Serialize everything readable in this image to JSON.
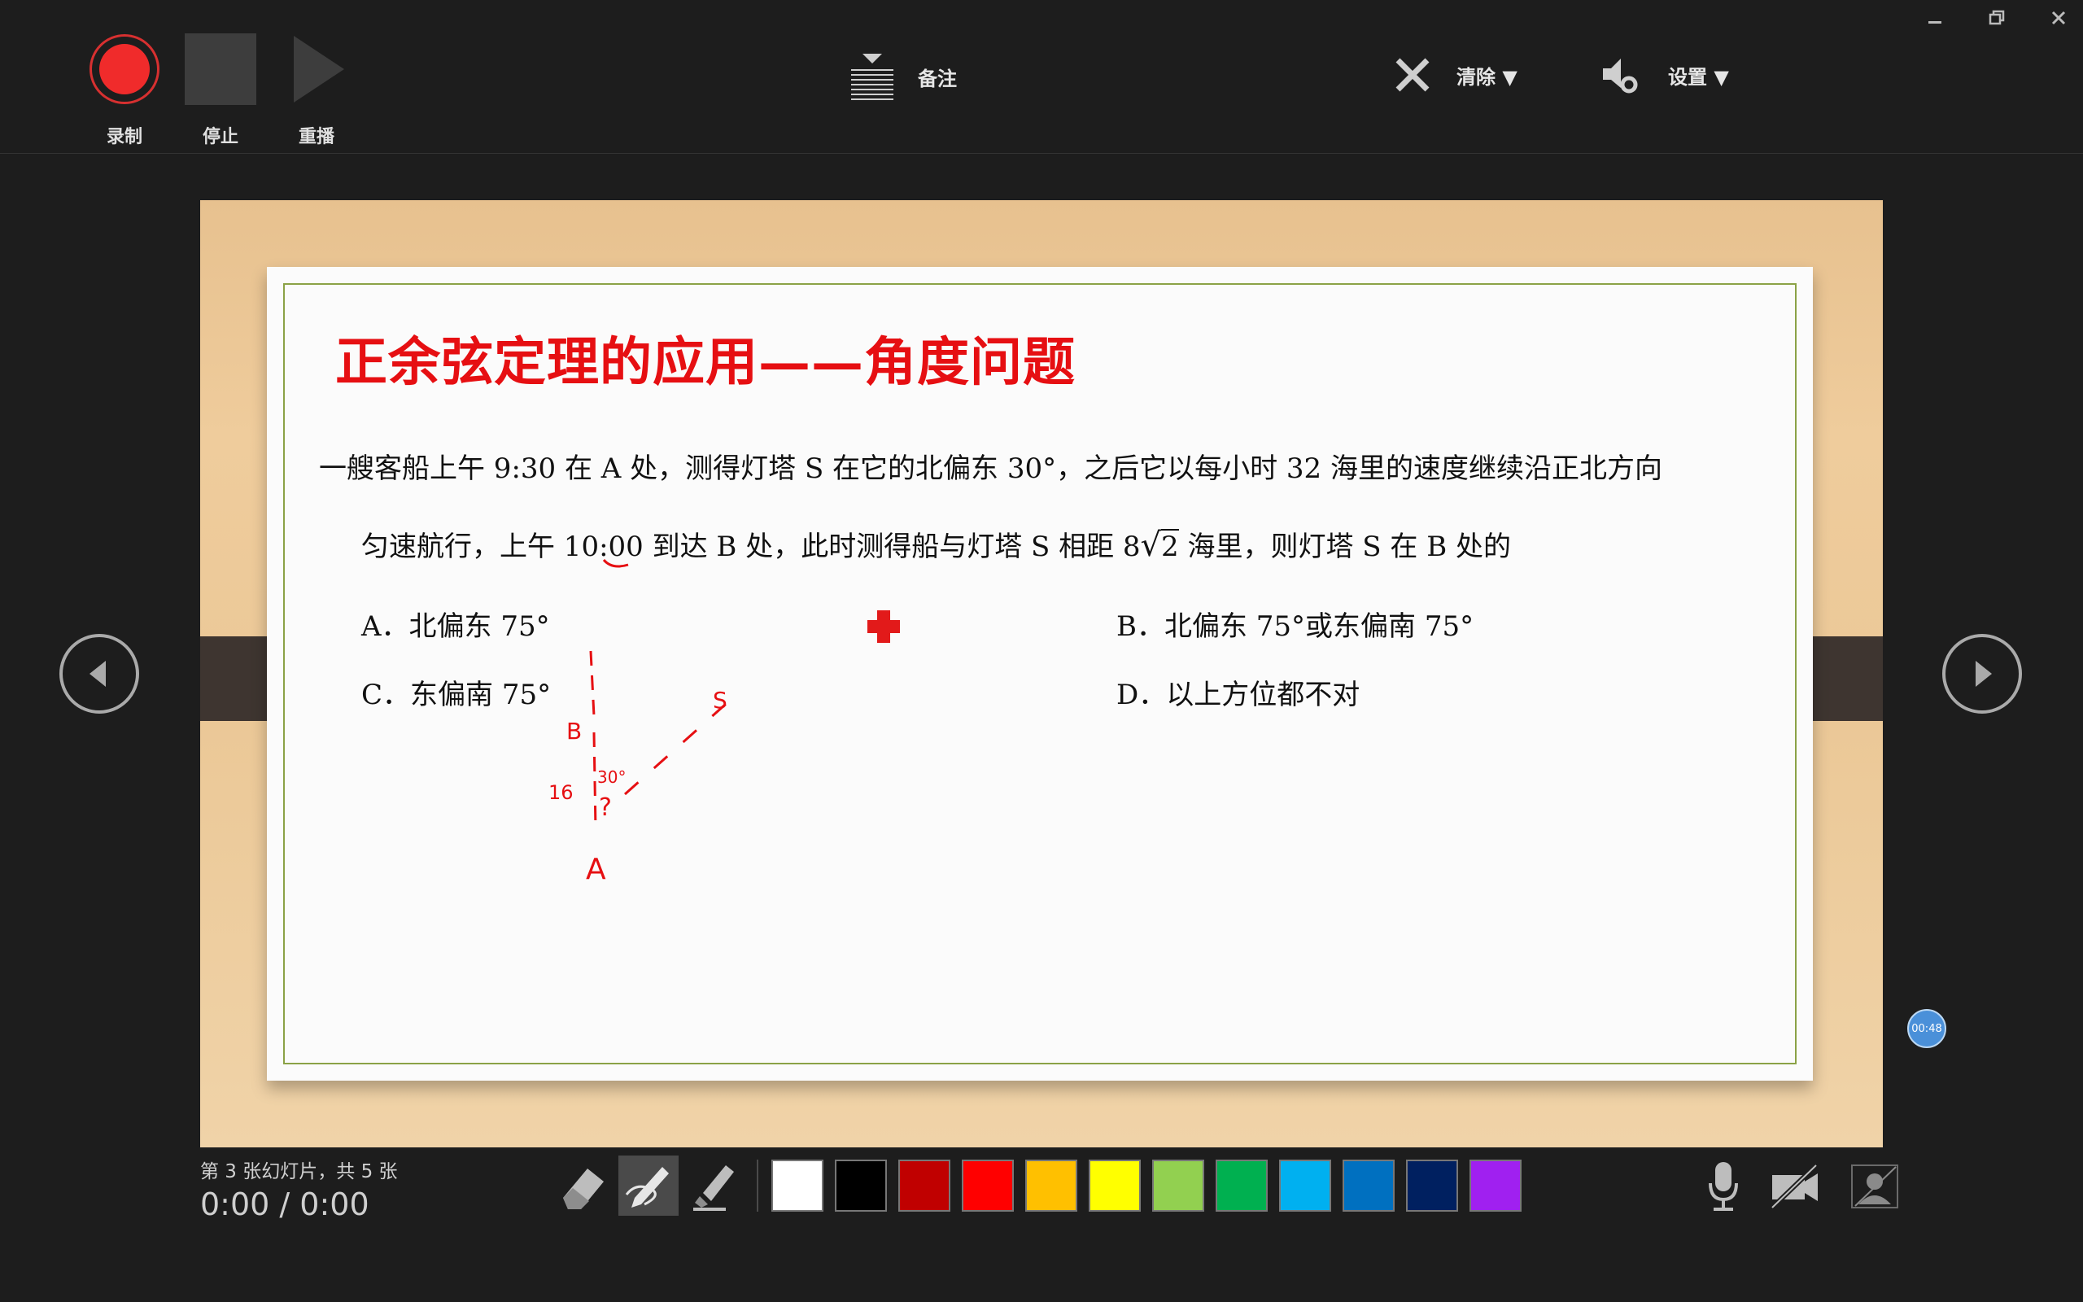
{
  "toolbar": {
    "record_label": "录制",
    "stop_label": "停止",
    "replay_label": "重播",
    "notes_label": "备注",
    "clear_label": "清除 ▼",
    "settings_label": "设置 ▼"
  },
  "slide": {
    "title": "正余弦定理的应用——角度问题",
    "question_line1": "一艘客船上午 9:30 在 A 处，测得灯塔 S 在它的北偏东 30°，之后它以每小时 32 海里的速度继续沿正北方向",
    "question_line2_a": "匀速航行，上午 10:00 到达 B 处，此时测得船与灯塔 S 相距 8",
    "question_line2_sqrt": "2",
    "question_line2_b": " 海里，则灯塔 S 在 B 处的",
    "option_a": "A．北偏东 75°",
    "option_b": "B．北偏东 75°或东偏南 75°",
    "option_c": "C．东偏南 75°",
    "option_d": "D．以上方位都不对",
    "ink_labels": {
      "b": "B",
      "s": "S",
      "a": "A",
      "sixteen": "16",
      "angle": "30°",
      "question": "?"
    }
  },
  "status": {
    "slide_count": "第 3 张幻灯片，共 5 张",
    "time": "0:00 / 0:00",
    "timer_badge": "00:48"
  },
  "pen_colors": [
    "#ffffff",
    "#000000",
    "#c00000",
    "#ff0000",
    "#ffc000",
    "#ffff00",
    "#92d050",
    "#00b050",
    "#00b0f0",
    "#0070c0",
    "#002060",
    "#a020f0"
  ],
  "accent_color": "#e60f12"
}
